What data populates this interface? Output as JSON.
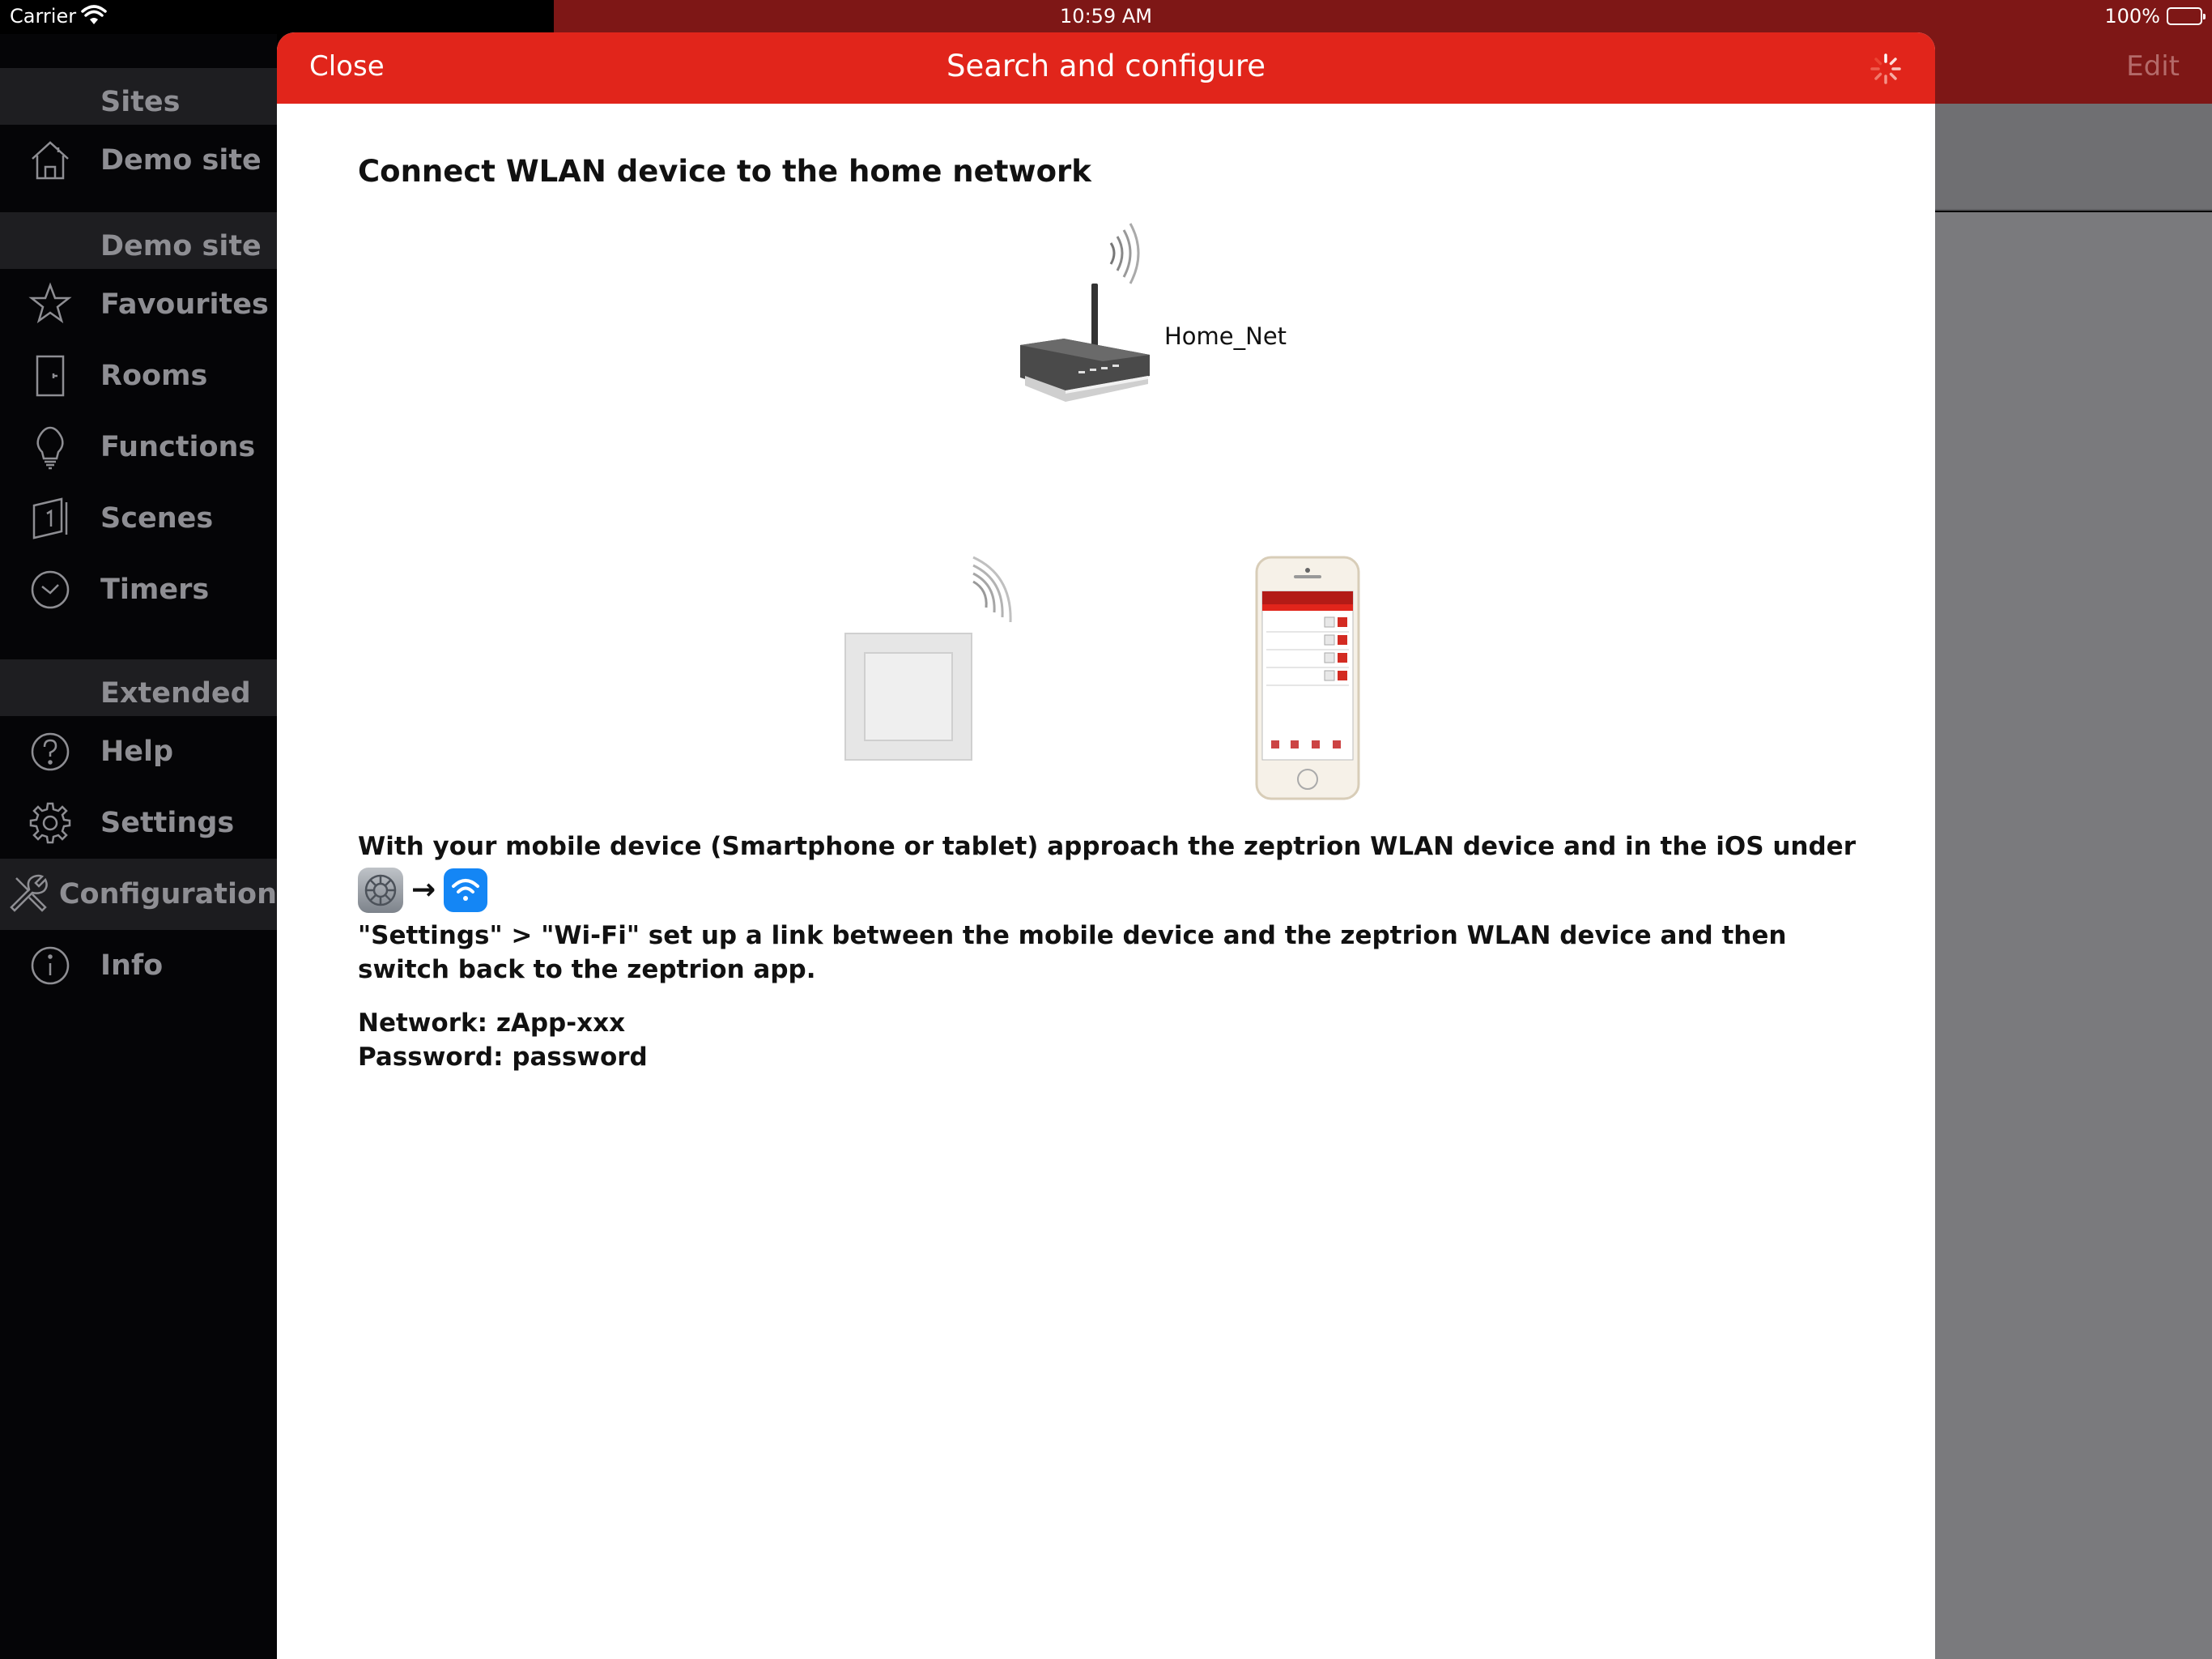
{
  "status_bar": {
    "carrier": "Carrier",
    "time": "10:59 AM",
    "battery": "100%",
    "wifi_icon": "wifi-signal-icon",
    "battery_icon": "battery-full-icon"
  },
  "background": {
    "edit_label": "Edit"
  },
  "sidebar": {
    "sections": [
      {
        "header": "Sites",
        "items": [
          {
            "label": "Demo site",
            "icon": "house-icon"
          }
        ]
      },
      {
        "header": "Demo site",
        "items": [
          {
            "label": "Favourites",
            "icon": "star-icon"
          },
          {
            "label": "Rooms",
            "icon": "door-icon"
          },
          {
            "label": "Functions",
            "icon": "lightbulb-icon"
          },
          {
            "label": "Scenes",
            "icon": "scene-icon"
          },
          {
            "label": "Timers",
            "icon": "clock-icon"
          }
        ]
      },
      {
        "header": "Extended",
        "items": [
          {
            "label": "Help",
            "icon": "help-icon"
          },
          {
            "label": "Settings",
            "icon": "gear-icon"
          },
          {
            "label": "Configuration",
            "icon": "tools-icon",
            "selected": true
          },
          {
            "label": "Info",
            "icon": "info-icon"
          }
        ]
      }
    ]
  },
  "modal": {
    "close_label": "Close",
    "title": "Search and configure",
    "spinner_icon": "loading-spinner-icon",
    "heading": "Connect WLAN device to the home network",
    "router_label": "Home_Net",
    "instruction_1": "With your mobile device (Smartphone or tablet) approach the zeptrion WLAN device and in the iOS under",
    "instruction_2": "\"Settings\" > \"Wi-Fi\" set up a link between the mobile device and the zeptrion WLAN device and then switch back to the zeptrion app.",
    "arrow": "→",
    "network_line": "Network: zApp-xxx",
    "password_line": "Password: password"
  },
  "colors": {
    "brand_red": "#e1251b",
    "dark_red": "#7e1716",
    "sidebar_bg": "#050507",
    "sidebar_text": "#8e8e93",
    "ios_blue": "#1486f5"
  }
}
